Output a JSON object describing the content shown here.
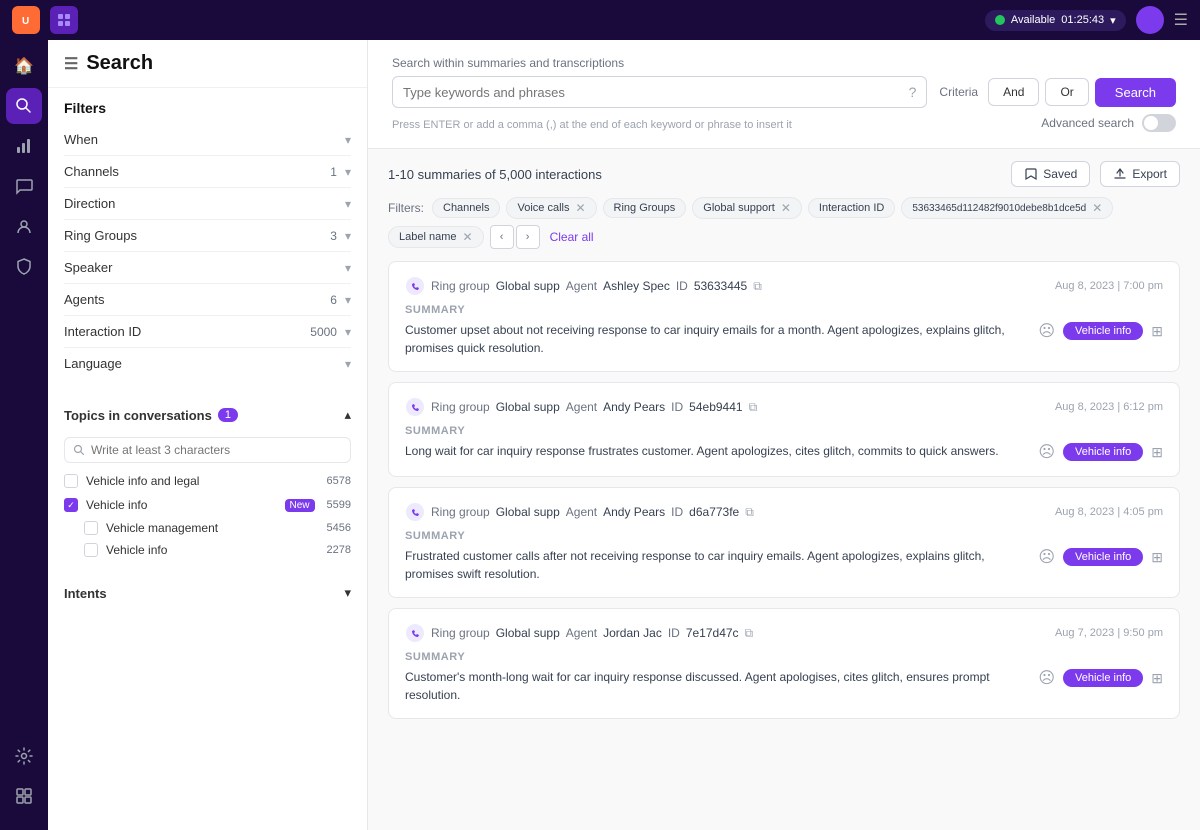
{
  "topbar": {
    "logo_text": "U",
    "status": "Available",
    "time": "01:25:43"
  },
  "page_title": "Search",
  "search": {
    "section_label": "Search within summaries and transcriptions",
    "placeholder": "Type keywords and phrases",
    "hint": "Press ENTER or add a comma (,) at the end of each keyword or phrase to insert it",
    "criteria_label": "Criteria",
    "and_label": "And",
    "or_label": "Or",
    "button_label": "Search",
    "advanced_label": "Advanced search"
  },
  "results": {
    "count_text": "1-10 summaries of 5,000 interactions",
    "saved_label": "Saved",
    "export_label": "Export"
  },
  "filters_bar": {
    "label": "Filters:",
    "chips": [
      {
        "text": "Channels",
        "type": "label"
      },
      {
        "text": "Voice calls",
        "removable": true
      },
      {
        "text": "Ring Groups",
        "type": "label"
      },
      {
        "text": "Global support",
        "removable": true
      },
      {
        "text": "Interaction ID",
        "type": "label"
      },
      {
        "text": "53633465d112482f9010debe8b1dce5d",
        "removable": true
      },
      {
        "text": "Label name",
        "removable": true
      }
    ],
    "clear_label": "Clear all"
  },
  "sidebar": {
    "title": "Search",
    "filters_title": "Filters",
    "filter_items": [
      {
        "label": "When",
        "count": ""
      },
      {
        "label": "Channels",
        "count": "1"
      },
      {
        "label": "Direction",
        "count": ""
      },
      {
        "label": "Ring Groups",
        "count": "3"
      },
      {
        "label": "Speaker",
        "count": ""
      },
      {
        "label": "Agents",
        "count": "6"
      },
      {
        "label": "Interaction ID",
        "count": "5000"
      },
      {
        "label": "Language",
        "count": ""
      }
    ],
    "topics_title": "Topics in conversations",
    "topics_count": "1",
    "topics_search_placeholder": "Write at least 3 characters",
    "topic_items": [
      {
        "label": "Vehicle info and legal",
        "count": "6578",
        "checked": false,
        "level": 0
      },
      {
        "label": "Vehicle info",
        "count": "5599",
        "checked": true,
        "new": true,
        "level": 0
      },
      {
        "label": "Vehicle management",
        "count": "5456",
        "checked": false,
        "level": 1
      },
      {
        "label": "Vehicle info",
        "count": "2278",
        "checked": false,
        "level": 1
      }
    ],
    "intents_title": "Intents"
  },
  "cards": [
    {
      "ring_group": "Global supp",
      "agent": "Ashley Spec",
      "id": "53633445",
      "date": "Aug 8, 2023 | 7:00 pm",
      "summary_label": "SUMMARY",
      "summary": "Customer upset about not receiving response to car inquiry emails for a month. Agent apologizes, explains glitch, promises quick resolution.",
      "badge": "Vehicle info"
    },
    {
      "ring_group": "Global supp",
      "agent": "Andy Pears",
      "id": "54eb9441",
      "date": "Aug 8, 2023 | 6:12 pm",
      "summary_label": "SUMMARY",
      "summary": "Long wait for car inquiry response frustrates customer. Agent apologizes, cites glitch, commits to quick answers.",
      "badge": "Vehicle info"
    },
    {
      "ring_group": "Global supp",
      "agent": "Andy Pears",
      "id": "d6a773fe",
      "date": "Aug 8, 2023 | 4:05 pm",
      "summary_label": "SUMMARY",
      "summary": "Frustrated customer calls after not receiving response to car inquiry emails. Agent apologizes, explains glitch, promises swift resolution.",
      "badge": "Vehicle info"
    },
    {
      "ring_group": "Global supp",
      "agent": "Jordan Jac",
      "id": "7e17d47c",
      "date": "Aug 7, 2023 | 9:50 pm",
      "summary_label": "SUMMARY",
      "summary": "Customer's month-long wait for car inquiry response discussed. Agent apologises, cites glitch, ensures prompt resolution.",
      "badge": "Vehicle info"
    }
  ]
}
